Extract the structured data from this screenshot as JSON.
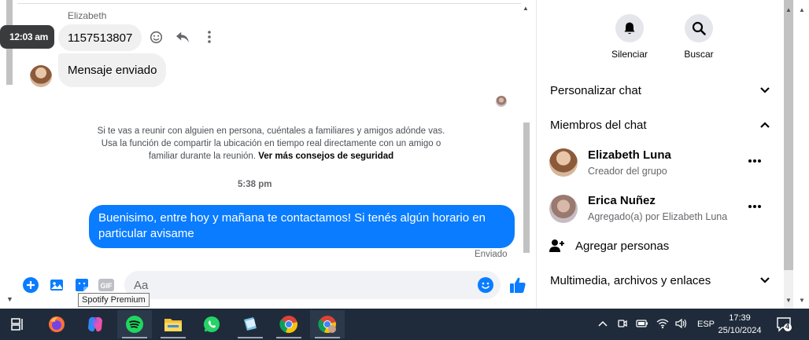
{
  "chat": {
    "sender_name": "Elizabeth",
    "messages_in": [
      {
        "text": "1157513807"
      },
      {
        "text": "Mensaje enviado"
      }
    ],
    "hover_time": "12:03 am",
    "safety_notice": "Si te vas a reunir con alguien en persona, cuéntales a familiares y amigos adónde vas. Usa la función de compartir la ubicación en tiempo real directamente con un amigo o familiar durante la reunión.",
    "safety_link": "Ver más consejos de seguridad",
    "time_separator": "5:38 pm",
    "message_out": "Buenisimo, entre hoy y mañana te contactamos! Si tenés algún horario en particular avisame",
    "sent_status": "Enviado",
    "composer_placeholder": "Aa",
    "tooltip": "Spotify Premium"
  },
  "info": {
    "actions": [
      {
        "label": "Silenciar",
        "icon": "bell-icon"
      },
      {
        "label": "Buscar",
        "icon": "search-icon"
      }
    ],
    "sections": {
      "customize": "Personalizar chat",
      "members": "Miembros del chat",
      "media": "Multimedia, archivos y enlaces"
    },
    "members": [
      {
        "name": "Elizabeth Luna",
        "role": "Creador del grupo"
      },
      {
        "name": "Erica Nuñez",
        "role": "Agregado(a) por Elizabeth Luna"
      }
    ],
    "add_people": "Agregar personas"
  },
  "taskbar": {
    "apps": [
      "task-view",
      "firefox",
      "copilot",
      "spotify",
      "file-explorer",
      "whatsapp",
      "notes",
      "chrome",
      "chrome-profile"
    ],
    "language": "ESP",
    "time": "17:39",
    "date": "25/10/2024",
    "notifications": "4"
  },
  "colors": {
    "messenger_blue": "#0a7cff",
    "taskbar": "#1f2b3b"
  }
}
